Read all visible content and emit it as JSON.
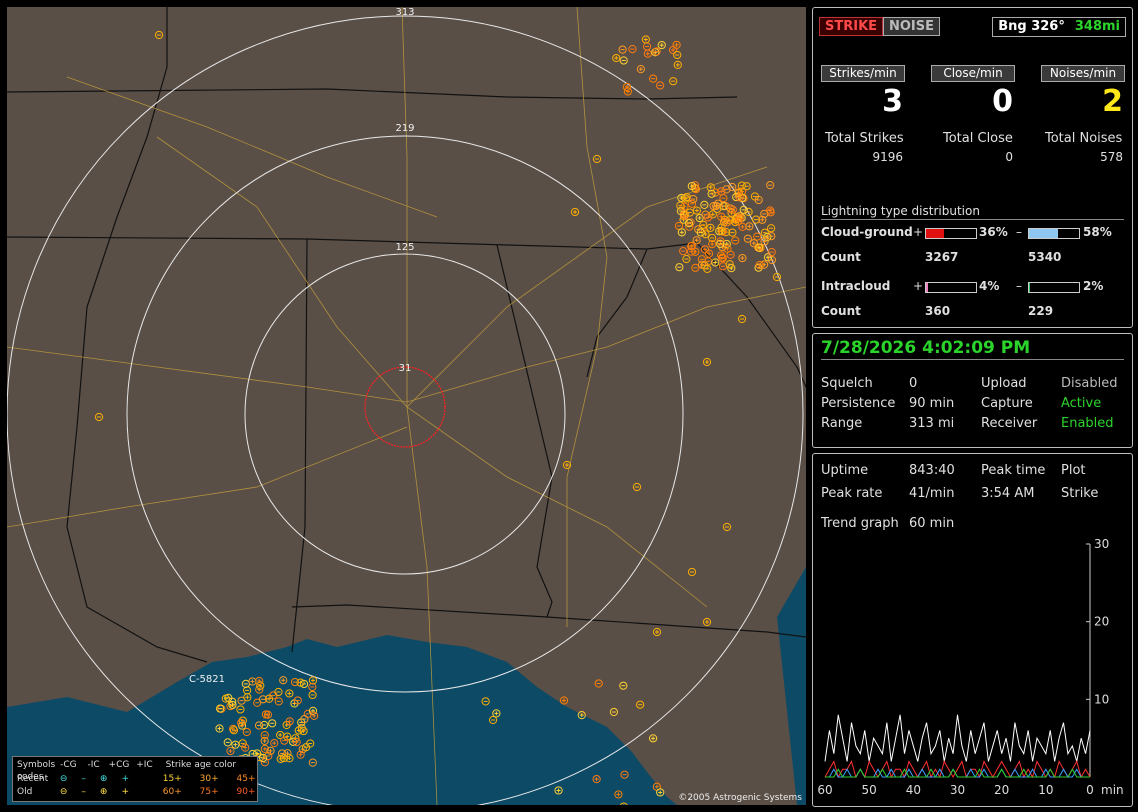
{
  "map": {
    "ring_labels": [
      "313",
      "219",
      "125",
      "31"
    ],
    "site_label": "C-5821",
    "copyright": "©2005 Astrogenic Systems",
    "legend": {
      "title": "Symbols",
      "cols": [
        "-CG",
        "-IC",
        "+CG",
        "+IC"
      ],
      "age_title": "Strike age color codes",
      "recent_label": "Recent",
      "old_label": "Old",
      "recent_ages": [
        "15+",
        "30+",
        "45+"
      ],
      "old_ages": [
        "60+",
        "75+",
        "90+"
      ]
    }
  },
  "status": {
    "strike_tag": "STRIKE",
    "noise_tag": "NOISE",
    "bearing": "Bng 326°",
    "distance": "348mi",
    "rates": {
      "strikes_label": "Strikes/min",
      "strikes_value": "3",
      "close_label": "Close/min",
      "close_value": "0",
      "noises_label": "Noises/min",
      "noises_value": "2"
    },
    "totals": {
      "strikes_label": "Total Strikes",
      "strikes_value": "9196",
      "close_label": "Total Close",
      "close_value": "0",
      "noises_label": "Total Noises",
      "noises_value": "578"
    },
    "distribution": {
      "title": "Lightning type distribution",
      "cg_label": "Cloud-ground",
      "ic_label": "Intracloud",
      "count_label": "Count",
      "plus": "+",
      "minus": "–",
      "cg_pos_pct": "36%",
      "cg_pos_fraction": 0.36,
      "cg_pos_count": "3267",
      "cg_neg_pct": "58%",
      "cg_neg_fraction": 0.58,
      "cg_neg_count": "5340",
      "ic_pos_pct": "4%",
      "ic_pos_fraction": 0.04,
      "ic_pos_count": "360",
      "ic_neg_pct": "2%",
      "ic_neg_fraction": 0.02,
      "ic_neg_count": "229"
    }
  },
  "settings": {
    "datetime": "7/28/2026 4:02:09 PM",
    "squelch_label": "Squelch",
    "squelch_value": "0",
    "persistence_label": "Persistence",
    "persistence_value": "90 min",
    "range_label": "Range",
    "range_value": "313 mi",
    "upload_label": "Upload",
    "upload_value": "Disabled",
    "capture_label": "Capture",
    "capture_value": "Active",
    "receiver_label": "Receiver",
    "receiver_value": "Enabled"
  },
  "stats": {
    "uptime_label": "Uptime",
    "uptime_value": "843:40",
    "peak_time_label": "Peak time",
    "peak_time_value": "3:54 AM",
    "plot_label": "Plot",
    "plot_value": "Strike",
    "peak_rate_label": "Peak rate",
    "peak_rate_value": "41/min",
    "trend_label": "Trend graph",
    "trend_value": "60 min"
  },
  "chart_data": {
    "type": "line",
    "x_ticks": [
      "60",
      "50",
      "40",
      "30",
      "20",
      "10",
      "0"
    ],
    "x_unit": "min",
    "y_ticks": [
      "30",
      "20",
      "10"
    ],
    "ylim": [
      0,
      30
    ],
    "xlim": [
      60,
      0
    ],
    "series": [
      {
        "color": "#ffffff",
        "values": [
          2,
          6,
          3,
          8,
          5,
          2,
          7,
          4,
          3,
          6,
          2,
          5,
          4,
          3,
          7,
          2,
          5,
          8,
          3,
          6,
          4,
          2,
          5,
          7,
          3,
          4,
          6,
          2,
          5,
          3,
          8,
          4,
          2,
          6,
          3,
          5,
          7,
          2,
          4,
          6,
          3,
          5,
          2,
          7,
          4,
          3,
          6,
          2,
          5,
          4,
          3,
          6,
          2,
          5,
          7,
          3,
          4,
          2,
          5,
          3,
          6
        ]
      },
      {
        "color": "#ff3030",
        "values": [
          0,
          1,
          2,
          0,
          1,
          1,
          2,
          0,
          1,
          0,
          2,
          1,
          0,
          1,
          2,
          0,
          1,
          1,
          0,
          2,
          1,
          0,
          1,
          2,
          0,
          1,
          0,
          2,
          1,
          0,
          1,
          2,
          0,
          1,
          1,
          0,
          2,
          1,
          0,
          1,
          2,
          1,
          0,
          1,
          2,
          0,
          1,
          0,
          2,
          1,
          0,
          1,
          0,
          2,
          1,
          0,
          1,
          2,
          0,
          1,
          0
        ]
      },
      {
        "color": "#3aa0ff",
        "values": [
          0,
          0,
          1,
          0,
          0,
          1,
          0,
          0,
          1,
          0,
          0,
          0,
          1,
          0,
          0,
          1,
          0,
          0,
          0,
          1,
          0,
          0,
          1,
          0,
          0,
          0,
          1,
          0,
          0,
          1,
          0,
          0,
          0,
          1,
          0,
          0,
          1,
          0,
          0,
          0,
          1,
          0,
          0,
          1,
          0,
          0,
          0,
          1,
          0,
          0,
          1,
          0,
          0,
          0,
          1,
          0,
          0,
          1,
          0,
          0,
          0
        ]
      },
      {
        "color": "#30d030",
        "values": [
          0,
          0,
          0,
          1,
          0,
          0,
          0,
          0,
          1,
          0,
          0,
          0,
          0,
          1,
          0,
          0,
          0,
          0,
          1,
          0,
          0,
          0,
          0,
          0,
          1,
          0,
          0,
          0,
          0,
          1,
          0,
          0,
          0,
          0,
          0,
          1,
          0,
          0,
          0,
          0,
          1,
          0,
          0,
          0,
          0,
          1,
          0,
          0,
          0,
          0,
          0,
          1,
          0,
          0,
          0,
          0,
          1,
          0,
          0,
          0,
          0
        ]
      }
    ]
  }
}
